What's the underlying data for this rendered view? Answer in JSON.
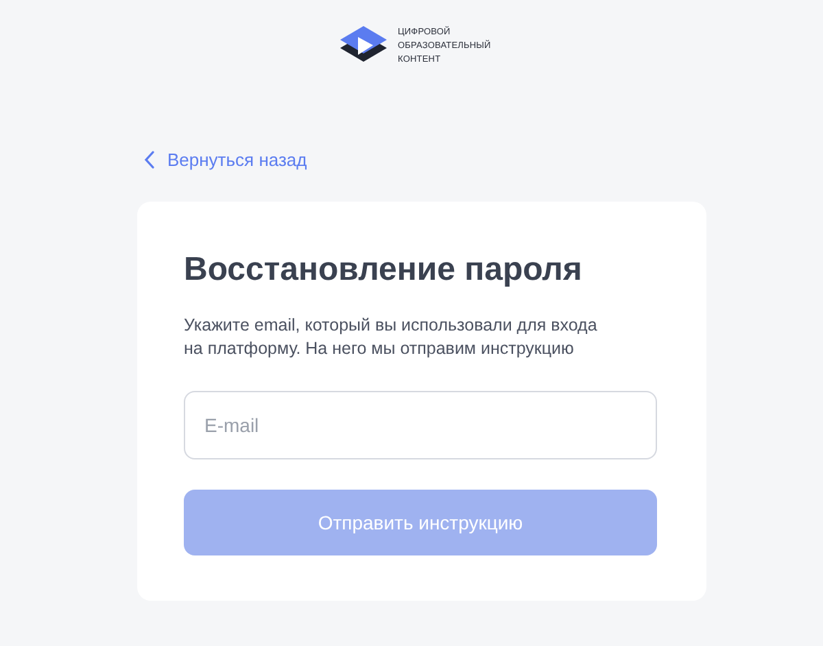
{
  "logo": {
    "lines": [
      "ЦИФРОВОЙ",
      "ОБРАЗОВАТЕЛЬНЫЙ",
      "КОНТЕНТ"
    ]
  },
  "back_link": {
    "label": "Вернуться назад"
  },
  "card": {
    "title": "Восстановление пароля",
    "description": "Укажите email, который вы использовали для входа на платформу. На него мы отправим инструкцию",
    "email_field": {
      "placeholder": "E-mail"
    },
    "submit_button": {
      "label": "Отправить инструкцию",
      "disabled": true
    }
  }
}
